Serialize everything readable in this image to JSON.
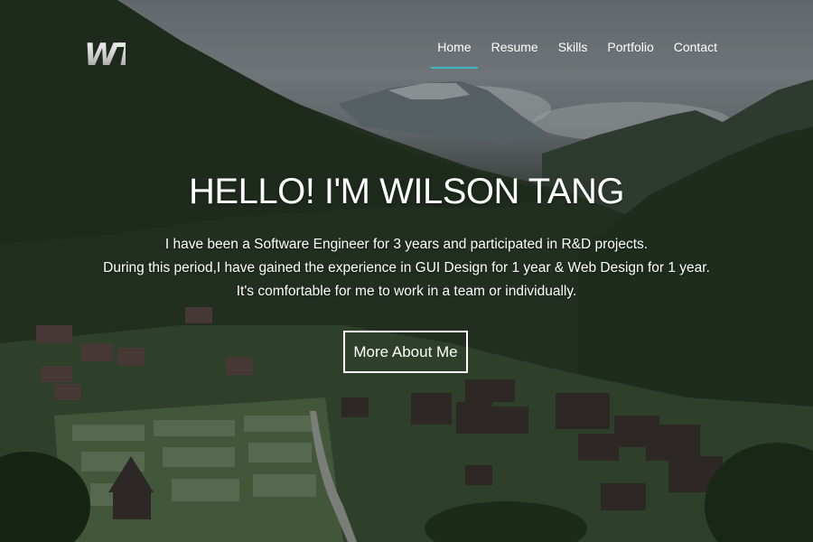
{
  "logo": {
    "text": "WT"
  },
  "nav": {
    "items": [
      {
        "label": "Home",
        "active": true
      },
      {
        "label": "Resume",
        "active": false
      },
      {
        "label": "Skills",
        "active": false
      },
      {
        "label": "Portfolio",
        "active": false
      },
      {
        "label": "Contact",
        "active": false
      }
    ],
    "active_underline_color": "#3bb6c8"
  },
  "hero": {
    "title": "HELLO! I'M WILSON TANG",
    "lines": [
      "I have been a Software Engineer for 3 years and participated in R&D projects.",
      "During this period,I have gained the experience in GUI Design for 1 year & Web Design for 1 year.",
      "It's comfortable for me to work in a team or individually."
    ],
    "button_label": "More About Me"
  },
  "background": {
    "description_icon": "mountain-village-photo"
  }
}
